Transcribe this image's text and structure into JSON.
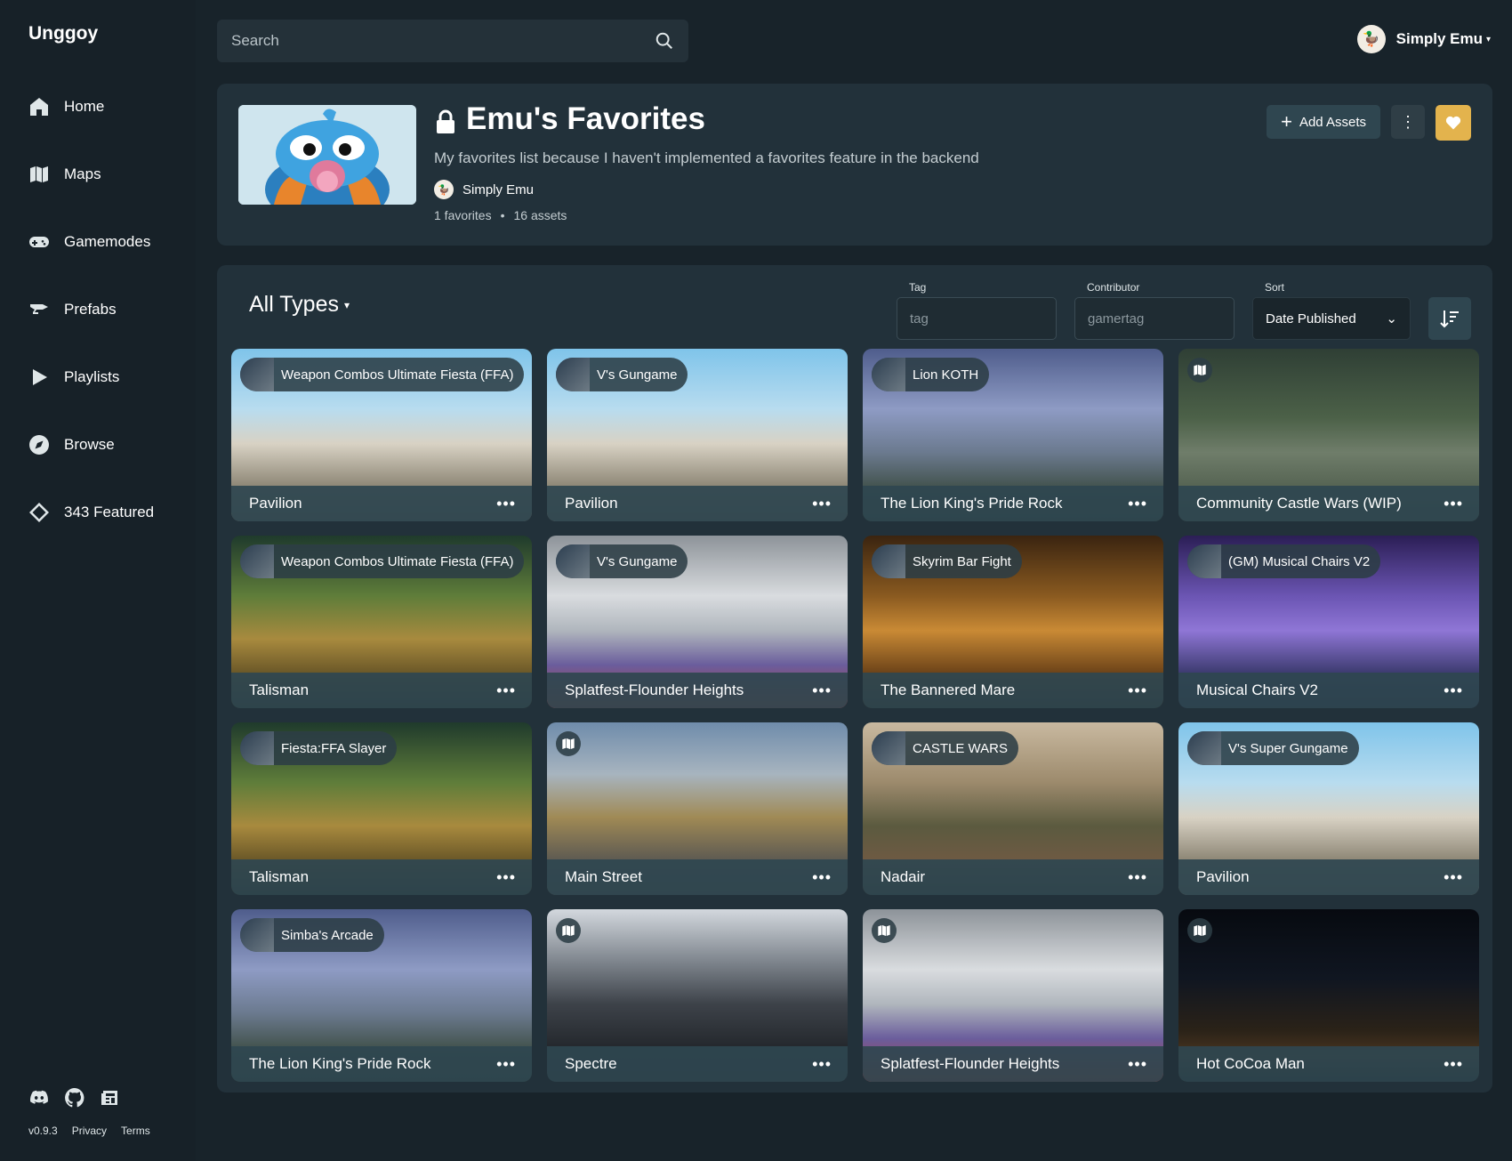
{
  "app": {
    "name": "Unggoy"
  },
  "nav": [
    {
      "label": "Home",
      "icon": "home-icon"
    },
    {
      "label": "Maps",
      "icon": "map-icon"
    },
    {
      "label": "Gamemodes",
      "icon": "gamepad-icon"
    },
    {
      "label": "Prefabs",
      "icon": "anvil-icon"
    },
    {
      "label": "Playlists",
      "icon": "play-icon"
    },
    {
      "label": "Browse",
      "icon": "compass-icon"
    },
    {
      "label": "343 Featured",
      "icon": "diamond-icon"
    }
  ],
  "footer": {
    "version": "v0.9.3",
    "privacy": "Privacy",
    "terms": "Terms"
  },
  "search": {
    "placeholder": "Search"
  },
  "user": {
    "name": "Simply Emu"
  },
  "playlist": {
    "title": "Emu's Favorites",
    "description": "My favorites list because I haven't implemented a favorites feature in the backend",
    "owner": "Simply Emu",
    "favorites": "1 favorites",
    "separator": "•",
    "assets": "16 assets",
    "add_assets_label": "Add Assets"
  },
  "filters": {
    "types_label": "All Types",
    "tag_label": "Tag",
    "tag_placeholder": "tag",
    "contributor_label": "Contributor",
    "contributor_placeholder": "gamertag",
    "sort_label": "Sort",
    "sort_value": "Date Published"
  },
  "assets": [
    {
      "name": "Pavilion",
      "badge": "Weapon Combos Ultimate Fiesta (FFA)",
      "scene": "pavilion"
    },
    {
      "name": "Pavilion",
      "badge": "V's Gungame",
      "scene": "pavilion"
    },
    {
      "name": "The Lion King's Pride Rock",
      "badge": "Lion KOTH",
      "scene": "pride"
    },
    {
      "name": "Community Castle Wars (WIP)",
      "badge": "",
      "scene": "castle"
    },
    {
      "name": "Talisman",
      "badge": "Weapon Combos Ultimate Fiesta (FFA)",
      "scene": "talisman"
    },
    {
      "name": "Splatfest-Flounder Heights",
      "badge": "V's Gungame",
      "scene": "splat"
    },
    {
      "name": "The Bannered Mare",
      "badge": "Skyrim Bar Fight",
      "scene": "mare"
    },
    {
      "name": "Musical Chairs V2",
      "badge": "(GM) Musical Chairs V2",
      "scene": "chairs"
    },
    {
      "name": "Talisman",
      "badge": "Fiesta:FFA Slayer",
      "scene": "talisman"
    },
    {
      "name": "Main Street",
      "badge": "",
      "scene": "street"
    },
    {
      "name": "Nadair",
      "badge": "CASTLE WARS",
      "scene": "nadair"
    },
    {
      "name": "Pavilion",
      "badge": "V's Super Gungame",
      "scene": "pavilion"
    },
    {
      "name": "The Lion King's Pride Rock",
      "badge": "Simba's Arcade",
      "scene": "pride"
    },
    {
      "name": "Spectre",
      "badge": "",
      "scene": "spectre"
    },
    {
      "name": "Splatfest-Flounder Heights",
      "badge": "",
      "scene": "splat"
    },
    {
      "name": "Hot CoCoa Man",
      "badge": "",
      "scene": "cocoa"
    }
  ],
  "colors": {
    "accent": "#e3b34d",
    "button": "#2f4650",
    "card": "#22313a",
    "background": "#18232a"
  }
}
